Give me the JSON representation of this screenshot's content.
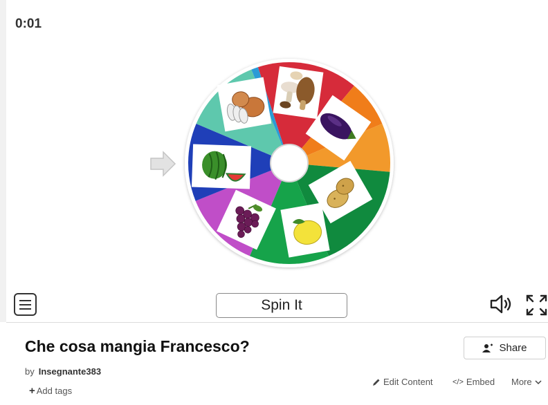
{
  "timer": "0:01",
  "wheel": {
    "segment_colors": [
      "#d62b3a",
      "#f07d1a",
      "#f2992b",
      "#108a3e",
      "#16a34a",
      "#c04ec8",
      "#1f3fb8",
      "#5ec8ad",
      "#2b9bd6"
    ],
    "items": [
      "mushrooms",
      "eggplant",
      "potatoes",
      "lemon",
      "grapes",
      "watermelon",
      "onions"
    ]
  },
  "controls": {
    "spin_label": "Spin It"
  },
  "activity": {
    "title": "Che cosa mangia Francesco?",
    "by_label": "by",
    "author": "Insegnante383",
    "share_label": "Share",
    "add_tags_label": "Add tags",
    "edit_content_label": "Edit Content",
    "embed_label": "Embed",
    "more_label": "More"
  }
}
